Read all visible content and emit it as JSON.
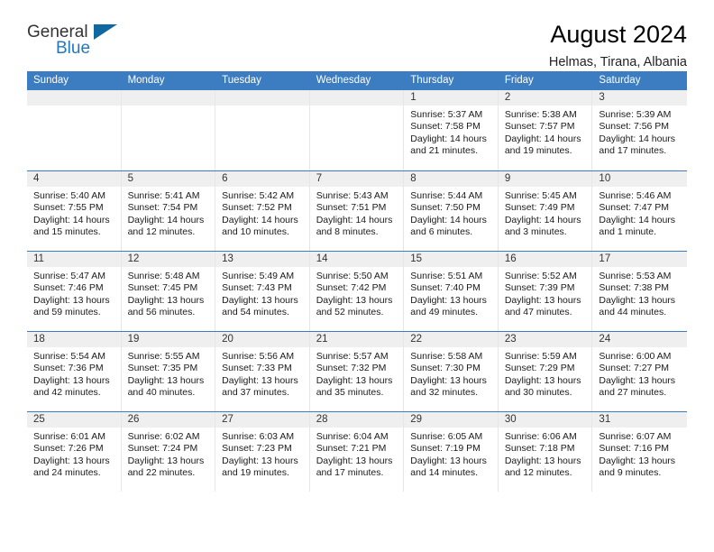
{
  "logo": {
    "word_one": "General",
    "word_two": "Blue",
    "shape": "blue-triangle"
  },
  "header": {
    "title": "August 2024",
    "subtitle": "Helmas, Tirana, Albania"
  },
  "theme": {
    "header_blue": "#3b7dc0",
    "daynum_gray": "#efefef",
    "logo_blue": "#2278c0",
    "text": "#1a1a1a"
  },
  "weekdays": [
    "Sunday",
    "Monday",
    "Tuesday",
    "Wednesday",
    "Thursday",
    "Friday",
    "Saturday"
  ],
  "weeks": [
    [
      {
        "day": "",
        "empty": true
      },
      {
        "day": "",
        "empty": true
      },
      {
        "day": "",
        "empty": true
      },
      {
        "day": "",
        "empty": true
      },
      {
        "day": "1",
        "sunrise": "Sunrise: 5:37 AM",
        "sunset": "Sunset: 7:58 PM",
        "daylight": "Daylight: 14 hours and 21 minutes."
      },
      {
        "day": "2",
        "sunrise": "Sunrise: 5:38 AM",
        "sunset": "Sunset: 7:57 PM",
        "daylight": "Daylight: 14 hours and 19 minutes."
      },
      {
        "day": "3",
        "sunrise": "Sunrise: 5:39 AM",
        "sunset": "Sunset: 7:56 PM",
        "daylight": "Daylight: 14 hours and 17 minutes."
      }
    ],
    [
      {
        "day": "4",
        "sunrise": "Sunrise: 5:40 AM",
        "sunset": "Sunset: 7:55 PM",
        "daylight": "Daylight: 14 hours and 15 minutes."
      },
      {
        "day": "5",
        "sunrise": "Sunrise: 5:41 AM",
        "sunset": "Sunset: 7:54 PM",
        "daylight": "Daylight: 14 hours and 12 minutes."
      },
      {
        "day": "6",
        "sunrise": "Sunrise: 5:42 AM",
        "sunset": "Sunset: 7:52 PM",
        "daylight": "Daylight: 14 hours and 10 minutes."
      },
      {
        "day": "7",
        "sunrise": "Sunrise: 5:43 AM",
        "sunset": "Sunset: 7:51 PM",
        "daylight": "Daylight: 14 hours and 8 minutes."
      },
      {
        "day": "8",
        "sunrise": "Sunrise: 5:44 AM",
        "sunset": "Sunset: 7:50 PM",
        "daylight": "Daylight: 14 hours and 6 minutes."
      },
      {
        "day": "9",
        "sunrise": "Sunrise: 5:45 AM",
        "sunset": "Sunset: 7:49 PM",
        "daylight": "Daylight: 14 hours and 3 minutes."
      },
      {
        "day": "10",
        "sunrise": "Sunrise: 5:46 AM",
        "sunset": "Sunset: 7:47 PM",
        "daylight": "Daylight: 14 hours and 1 minute."
      }
    ],
    [
      {
        "day": "11",
        "sunrise": "Sunrise: 5:47 AM",
        "sunset": "Sunset: 7:46 PM",
        "daylight": "Daylight: 13 hours and 59 minutes."
      },
      {
        "day": "12",
        "sunrise": "Sunrise: 5:48 AM",
        "sunset": "Sunset: 7:45 PM",
        "daylight": "Daylight: 13 hours and 56 minutes."
      },
      {
        "day": "13",
        "sunrise": "Sunrise: 5:49 AM",
        "sunset": "Sunset: 7:43 PM",
        "daylight": "Daylight: 13 hours and 54 minutes."
      },
      {
        "day": "14",
        "sunrise": "Sunrise: 5:50 AM",
        "sunset": "Sunset: 7:42 PM",
        "daylight": "Daylight: 13 hours and 52 minutes."
      },
      {
        "day": "15",
        "sunrise": "Sunrise: 5:51 AM",
        "sunset": "Sunset: 7:40 PM",
        "daylight": "Daylight: 13 hours and 49 minutes."
      },
      {
        "day": "16",
        "sunrise": "Sunrise: 5:52 AM",
        "sunset": "Sunset: 7:39 PM",
        "daylight": "Daylight: 13 hours and 47 minutes."
      },
      {
        "day": "17",
        "sunrise": "Sunrise: 5:53 AM",
        "sunset": "Sunset: 7:38 PM",
        "daylight": "Daylight: 13 hours and 44 minutes."
      }
    ],
    [
      {
        "day": "18",
        "sunrise": "Sunrise: 5:54 AM",
        "sunset": "Sunset: 7:36 PM",
        "daylight": "Daylight: 13 hours and 42 minutes."
      },
      {
        "day": "19",
        "sunrise": "Sunrise: 5:55 AM",
        "sunset": "Sunset: 7:35 PM",
        "daylight": "Daylight: 13 hours and 40 minutes."
      },
      {
        "day": "20",
        "sunrise": "Sunrise: 5:56 AM",
        "sunset": "Sunset: 7:33 PM",
        "daylight": "Daylight: 13 hours and 37 minutes."
      },
      {
        "day": "21",
        "sunrise": "Sunrise: 5:57 AM",
        "sunset": "Sunset: 7:32 PM",
        "daylight": "Daylight: 13 hours and 35 minutes."
      },
      {
        "day": "22",
        "sunrise": "Sunrise: 5:58 AM",
        "sunset": "Sunset: 7:30 PM",
        "daylight": "Daylight: 13 hours and 32 minutes."
      },
      {
        "day": "23",
        "sunrise": "Sunrise: 5:59 AM",
        "sunset": "Sunset: 7:29 PM",
        "daylight": "Daylight: 13 hours and 30 minutes."
      },
      {
        "day": "24",
        "sunrise": "Sunrise: 6:00 AM",
        "sunset": "Sunset: 7:27 PM",
        "daylight": "Daylight: 13 hours and 27 minutes."
      }
    ],
    [
      {
        "day": "25",
        "sunrise": "Sunrise: 6:01 AM",
        "sunset": "Sunset: 7:26 PM",
        "daylight": "Daylight: 13 hours and 24 minutes."
      },
      {
        "day": "26",
        "sunrise": "Sunrise: 6:02 AM",
        "sunset": "Sunset: 7:24 PM",
        "daylight": "Daylight: 13 hours and 22 minutes."
      },
      {
        "day": "27",
        "sunrise": "Sunrise: 6:03 AM",
        "sunset": "Sunset: 7:23 PM",
        "daylight": "Daylight: 13 hours and 19 minutes."
      },
      {
        "day": "28",
        "sunrise": "Sunrise: 6:04 AM",
        "sunset": "Sunset: 7:21 PM",
        "daylight": "Daylight: 13 hours and 17 minutes."
      },
      {
        "day": "29",
        "sunrise": "Sunrise: 6:05 AM",
        "sunset": "Sunset: 7:19 PM",
        "daylight": "Daylight: 13 hours and 14 minutes."
      },
      {
        "day": "30",
        "sunrise": "Sunrise: 6:06 AM",
        "sunset": "Sunset: 7:18 PM",
        "daylight": "Daylight: 13 hours and 12 minutes."
      },
      {
        "day": "31",
        "sunrise": "Sunrise: 6:07 AM",
        "sunset": "Sunset: 7:16 PM",
        "daylight": "Daylight: 13 hours and 9 minutes."
      }
    ]
  ]
}
